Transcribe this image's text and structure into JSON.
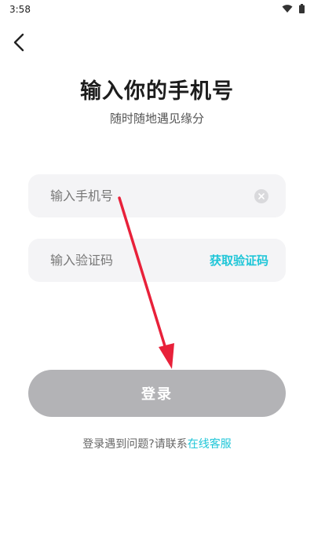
{
  "status_bar": {
    "time": "3:58"
  },
  "header": {
    "title": "输入你的手机号",
    "subtitle": "随时随地遇见缘分"
  },
  "form": {
    "phone_placeholder": "输入手机号",
    "code_placeholder": "输入验证码",
    "get_code_label": "获取验证码",
    "login_label": "登录"
  },
  "help": {
    "text": "登录遇到问题?请联系",
    "link": "在线客服"
  },
  "colors": {
    "accent": "#1fc6d8",
    "login_disabled": "#b3b3b6",
    "field_bg": "#f4f4f6",
    "annotation_arrow": "#e8213a"
  },
  "icons": [
    "back-arrow-icon",
    "wifi-icon",
    "battery-icon",
    "clear-icon"
  ]
}
